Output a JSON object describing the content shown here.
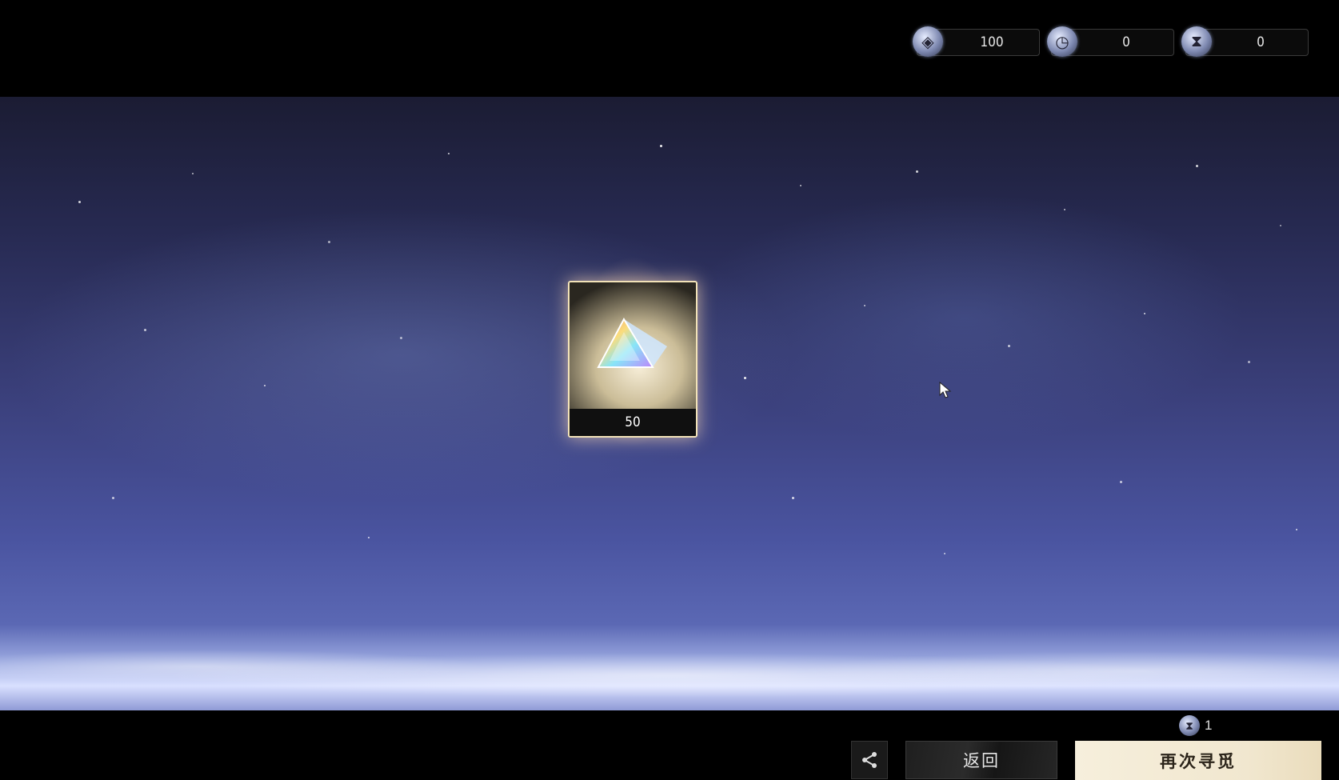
{
  "currencies": [
    {
      "icon": "crystal-icon",
      "value": "100"
    },
    {
      "icon": "clock-ticket-icon",
      "value": "0"
    },
    {
      "icon": "hourglass-icon",
      "value": "0"
    }
  ],
  "reward": {
    "icon": "prism-crystal-icon",
    "count": "50"
  },
  "cost": {
    "icon": "hourglass-icon",
    "amount": "1"
  },
  "buttons": {
    "share_icon": "share-icon",
    "back_label": "返回",
    "again_label": "再次寻觅"
  },
  "colors": {
    "again_button_bg": "#f4ecd8",
    "card_frame": "#f2e2b8"
  }
}
